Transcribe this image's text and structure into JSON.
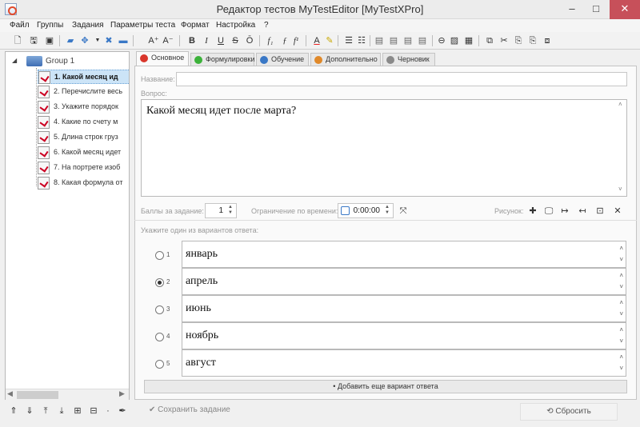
{
  "window": {
    "title": "Редактор тестов MyTestEditor [MyTestXPro]",
    "minimize": "–",
    "maximize": "□",
    "close": "✕"
  },
  "menu": [
    "Файл",
    "Группы",
    "Задания",
    "Параметры теста",
    "Формат",
    "Настройка",
    "?"
  ],
  "toolbar": {
    "icons": [
      "new-file-icon",
      "open-file-icon",
      "save-icon",
      "folder-icon",
      "arrows-icon",
      "dropdown-icon",
      "shuffle-icon",
      "minus-icon",
      "font-grow-icon",
      "font-shrink-icon",
      "bold-icon",
      "italic-icon",
      "underline-icon",
      "strikethrough-icon",
      "overline-icon",
      "subscript-icon",
      "function-icon",
      "superscript-icon",
      "font-color-icon",
      "highlight-icon",
      "bullet-list-icon",
      "numbered-list-icon",
      "align-left-icon",
      "align-center-icon",
      "align-right-icon",
      "justify-icon",
      "symbol-icon",
      "image-icon",
      "table-icon",
      "copy-icon",
      "cut-icon",
      "paste-icon",
      "paste-special-icon",
      "format-painter-icon"
    ],
    "bold": "B",
    "italic": "I",
    "underline": "U",
    "strike": "S",
    "overline": "Ō",
    "font_grow": "A⁺",
    "font_shrink": "A⁻",
    "font_color": "A"
  },
  "tree": {
    "root_label": "Group 1",
    "items": [
      "1. Какой месяц ид",
      "2. Перечислите весь",
      "3. Укажите порядок",
      "4. Какие по счету м",
      "5. Длина строк груз",
      "6. Какой месяц идет",
      "7. На портрете изоб",
      "8. Какая формула от"
    ],
    "selected_index": 0
  },
  "tabs": [
    {
      "label": "Основное",
      "color": "#d9362b"
    },
    {
      "label": "Формулировки",
      "color": "#3cb23a"
    },
    {
      "label": "Обучение",
      "color": "#3a78c6"
    },
    {
      "label": "Дополнительно",
      "color": "#e0892a"
    },
    {
      "label": "Черновик",
      "color": "#8a8a8a"
    }
  ],
  "task": {
    "name_label": "Название:",
    "name_value": "",
    "question_label": "Вопрос:",
    "question_text": "Какой месяц идет после марта?"
  },
  "settings": {
    "points_label": "Баллы за задание:",
    "points_value": "1",
    "time_label": "Ограничение по времени:",
    "time_value": "0:00:00",
    "picture_label": "Рисунок:"
  },
  "answers": {
    "hint": "Укажите один из вариантов ответа:",
    "items": [
      {
        "num": "1",
        "text": "январь",
        "selected": false
      },
      {
        "num": "2",
        "text": "апрель",
        "selected": true
      },
      {
        "num": "3",
        "text": "июнь",
        "selected": false
      },
      {
        "num": "4",
        "text": "ноябрь",
        "selected": false
      },
      {
        "num": "5",
        "text": "август",
        "selected": false
      }
    ],
    "add_label": "Добавить еще вариант ответа"
  },
  "footer": {
    "save_label": "Сохранить задание",
    "reset_label": "Сбросить"
  }
}
